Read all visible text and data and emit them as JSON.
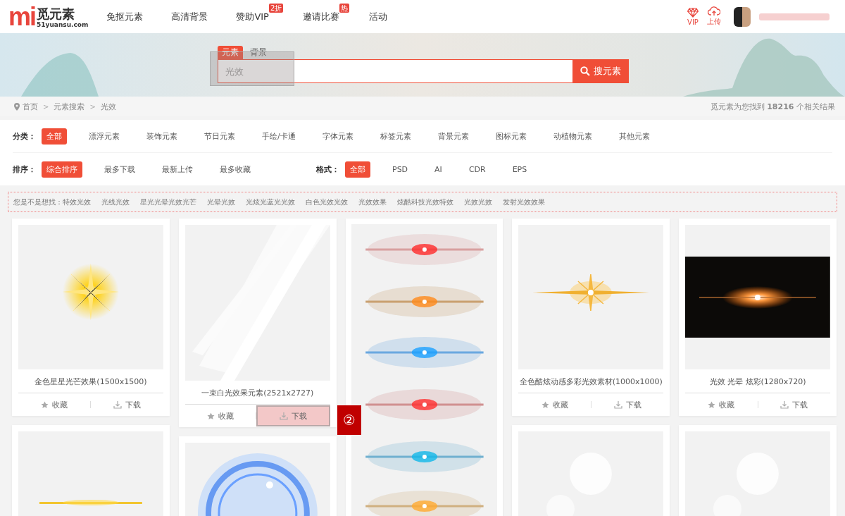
{
  "header": {
    "logo": {
      "mark": "mi",
      "name": "觅元素",
      "domain": "51yuansu.com"
    },
    "nav": [
      {
        "label": "免抠元素"
      },
      {
        "label": "高清背景"
      },
      {
        "label": "赞助VIP",
        "badge": "2折"
      },
      {
        "label": "邀请比赛",
        "badge": "热"
      },
      {
        "label": "活动"
      }
    ],
    "actions": [
      {
        "kind": "vip",
        "label": "VIP"
      },
      {
        "kind": "upload",
        "label": "上传"
      }
    ]
  },
  "search": {
    "tabs": [
      {
        "label": "元素",
        "selected": true
      },
      {
        "label": "背景",
        "selected": false
      }
    ],
    "placeholder": "光效",
    "highlighted": true,
    "button": "搜元素"
  },
  "breadcrumb": {
    "items": [
      {
        "kind": "link",
        "text": "首页"
      },
      {
        "kind": "separator",
        "text": ">"
      },
      {
        "kind": "link",
        "text": "元素搜索"
      },
      {
        "kind": "separator",
        "text": ">"
      },
      {
        "kind": "link",
        "text": "光效"
      }
    ],
    "result": "觅元素为您找到 **18216** 个相关结果"
  },
  "filters": {
    "category": {
      "label": "分类：",
      "options": [
        {
          "label": "全部",
          "selected": true
        },
        {
          "label": "漂浮元素",
          "selected": false
        },
        {
          "label": "装饰元素",
          "selected": false
        },
        {
          "label": "节日元素",
          "selected": false
        },
        {
          "label": "手绘/卡通",
          "selected": false
        },
        {
          "label": "字体元素",
          "selected": false
        },
        {
          "label": "标签元素",
          "selected": false
        },
        {
          "label": "背景元素",
          "selected": false
        },
        {
          "label": "图标元素",
          "selected": false
        },
        {
          "label": "动植物元素",
          "selected": false
        },
        {
          "label": "其他元素",
          "selected": false
        }
      ]
    },
    "sort": {
      "label": "排序：",
      "options": [
        {
          "label": "综合排序",
          "selected": true
        },
        {
          "label": "最多下载",
          "selected": false
        },
        {
          "label": "最新上传",
          "selected": false
        },
        {
          "label": "最多收藏",
          "selected": false
        }
      ]
    },
    "format": {
      "label": "格式：",
      "options": [
        {
          "label": "全部",
          "selected": true
        },
        {
          "label": "PSD",
          "selected": false
        },
        {
          "label": "AI",
          "selected": false
        },
        {
          "label": "CDR",
          "selected": false
        },
        {
          "label": "EPS",
          "selected": false
        }
      ]
    }
  },
  "suggestions": {
    "label": "您是不是想找：",
    "items": [
      "特效光效",
      "光线光效",
      "星光光晕光效光芒",
      "光晕光效",
      "光炫光蓝光光效",
      "白色光效光效",
      "光效效果",
      "炫酷科技光效特效",
      "光效光效",
      "发射光效效果"
    ]
  },
  "grid": {
    "columns": [
      {
        "cards": [
          {
            "kind": "card",
            "caption": "金色星星光芒效果(1500x1500)",
            "collect": "收藏",
            "download": "下载",
            "download_highlighted": false
          },
          {
            "kind": "picture"
          }
        ]
      },
      {
        "cards": [
          {
            "kind": "card",
            "caption": "一束白光效果元素(2521x2727)",
            "collect": "收藏",
            "download": "下载",
            "download_highlighted": true
          },
          {
            "kind": "picture"
          }
        ]
      },
      {
        "cards": [
          {
            "kind": "picture"
          }
        ]
      },
      {
        "cards": [
          {
            "kind": "card",
            "caption": "全色酷炫动感多彩光效素材(1000x1000)",
            "collect": "收藏",
            "download": "下载",
            "download_highlighted": false
          },
          {
            "kind": "picture"
          }
        ]
      },
      {
        "cards": [
          {
            "kind": "card",
            "caption": "光效 光晕 炫彩(1280x720)",
            "collect": "收藏",
            "download": "下载",
            "download_highlighted": false
          },
          {
            "kind": "picture"
          }
        ]
      }
    ]
  },
  "annotation": {
    "label": "②"
  }
}
